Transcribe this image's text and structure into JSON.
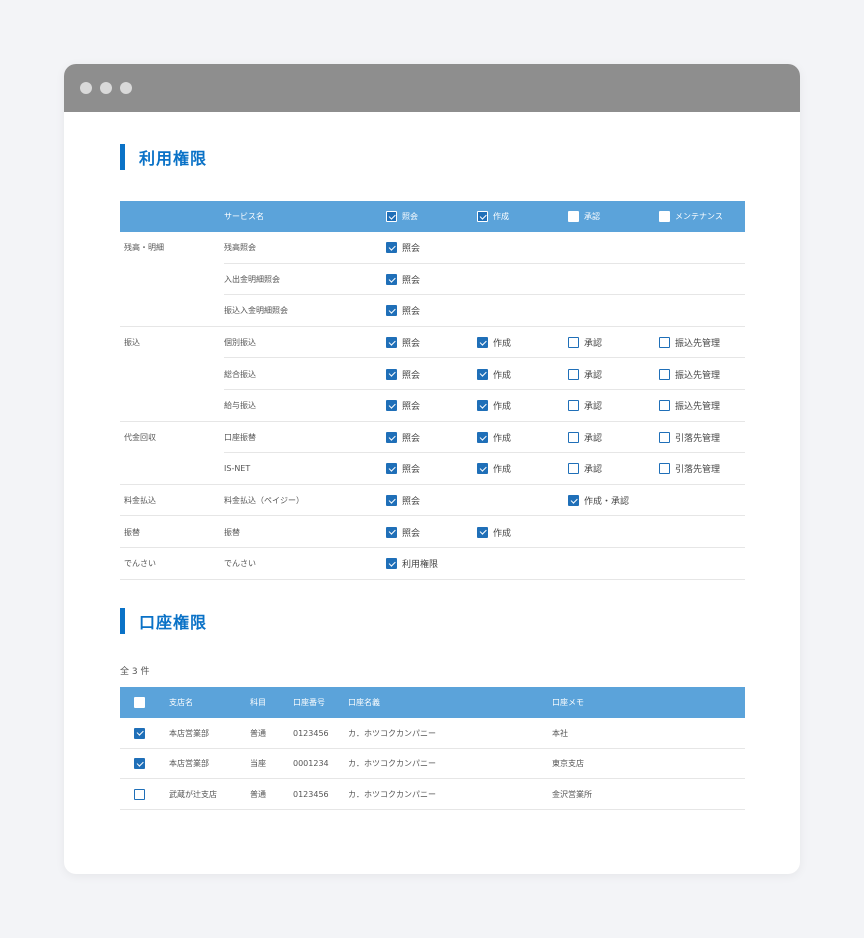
{
  "sections": {
    "permissions_title": "利用権限",
    "accounts_title": "口座権限"
  },
  "perm_header": {
    "service_col": "サービス名",
    "col1": {
      "label": "照会",
      "checked": true
    },
    "col2": {
      "label": "作成",
      "checked": true
    },
    "col3": {
      "label": "承認",
      "checked": false
    },
    "col4": {
      "label": "メンテナンス",
      "checked": false
    }
  },
  "perm_rows": [
    {
      "category": "残高・明細",
      "service": "残高照会",
      "c1": {
        "label": "照会",
        "checked": true
      }
    },
    {
      "category": "",
      "service": "入出金明細照会",
      "c1": {
        "label": "照会",
        "checked": true
      }
    },
    {
      "category": "",
      "service": "振込入金明細照会",
      "c1": {
        "label": "照会",
        "checked": true
      }
    },
    {
      "category": "振込",
      "service": "個別振込",
      "c1": {
        "label": "照会",
        "checked": true
      },
      "c2": {
        "label": "作成",
        "checked": true
      },
      "c3": {
        "label": "承認",
        "checked": false
      },
      "c4": {
        "label": "振込先管理",
        "checked": false
      }
    },
    {
      "category": "",
      "service": "総合振込",
      "c1": {
        "label": "照会",
        "checked": true
      },
      "c2": {
        "label": "作成",
        "checked": true
      },
      "c3": {
        "label": "承認",
        "checked": false
      },
      "c4": {
        "label": "振込先管理",
        "checked": false
      }
    },
    {
      "category": "",
      "service": "給与振込",
      "c1": {
        "label": "照会",
        "checked": true
      },
      "c2": {
        "label": "作成",
        "checked": true
      },
      "c3": {
        "label": "承認",
        "checked": false
      },
      "c4": {
        "label": "振込先管理",
        "checked": false
      }
    },
    {
      "category": "代金回収",
      "service": "口座振替",
      "c1": {
        "label": "照会",
        "checked": true
      },
      "c2": {
        "label": "作成",
        "checked": true
      },
      "c3": {
        "label": "承認",
        "checked": false
      },
      "c4": {
        "label": "引落先管理",
        "checked": false
      }
    },
    {
      "category": "",
      "service": "IS-NET",
      "c1": {
        "label": "照会",
        "checked": true
      },
      "c2": {
        "label": "作成",
        "checked": true
      },
      "c3": {
        "label": "承認",
        "checked": false
      },
      "c4": {
        "label": "引落先管理",
        "checked": false
      }
    },
    {
      "category": "料金払込",
      "service": "料金払込（ペイジー）",
      "c1": {
        "label": "照会",
        "checked": true
      },
      "c3": {
        "label": "作成・承認",
        "checked": true
      }
    },
    {
      "category": "振替",
      "service": "振替",
      "c1": {
        "label": "照会",
        "checked": true
      },
      "c2": {
        "label": "作成",
        "checked": true
      }
    },
    {
      "category": "でんさい",
      "service": "でんさい",
      "c1": {
        "label": "利用権限",
        "checked": true
      }
    }
  ],
  "accounts": {
    "count_text": "全 3 件",
    "header": {
      "branch": "支店名",
      "type": "科目",
      "number": "口座番号",
      "name": "口座名義",
      "memo": "口座メモ",
      "checked": false
    },
    "rows": [
      {
        "checked": true,
        "branch": "本店営業部",
        "type": "普通",
        "number": "0123456",
        "name": "カ．ホツコクカンパニー",
        "memo": "本社"
      },
      {
        "checked": true,
        "branch": "本店営業部",
        "type": "当座",
        "number": "0001234",
        "name": "カ．ホツコクカンパニー",
        "memo": "東京支店"
      },
      {
        "checked": false,
        "branch": "武蔵が辻支店",
        "type": "普通",
        "number": "0123456",
        "name": "カ．ホツコクカンパニー",
        "memo": "金沢営業所"
      }
    ]
  },
  "colors": {
    "accent": "#0a72c7",
    "header_bg": "#5ba3da",
    "titlebar": "#8e8e8e"
  }
}
